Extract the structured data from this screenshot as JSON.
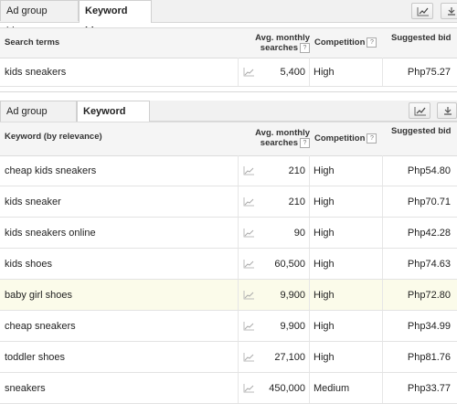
{
  "top_panel": {
    "tabs": [
      {
        "label": "Ad group ideas",
        "active": false
      },
      {
        "label": "Keyword ideas",
        "active": true
      }
    ],
    "headers": {
      "keyword": "Search terms",
      "avg_searches_line1": "Avg. monthly",
      "avg_searches_line2": "searches",
      "competition": "Competition",
      "suggested_bid": "Suggested bid",
      "help_glyph": "?"
    },
    "rows": [
      {
        "keyword": "kids sneakers",
        "searches": "5,400",
        "competition": "High",
        "bid": "Php75.27"
      }
    ]
  },
  "bottom_panel": {
    "tabs": [
      {
        "label": "Ad group ideas",
        "active": false
      },
      {
        "label": "Keyword ideas",
        "active": true
      }
    ],
    "headers": {
      "keyword": "Keyword (by relevance)",
      "avg_searches_line1": "Avg. monthly",
      "avg_searches_line2": "searches",
      "competition": "Competition",
      "suggested_bid": "Suggested bid",
      "help_glyph": "?"
    },
    "rows": [
      {
        "keyword": "cheap kids sneakers",
        "searches": "210",
        "competition": "High",
        "bid": "Php54.80",
        "highlighted": false
      },
      {
        "keyword": "kids sneaker",
        "searches": "210",
        "competition": "High",
        "bid": "Php70.71",
        "highlighted": false
      },
      {
        "keyword": "kids sneakers online",
        "searches": "90",
        "competition": "High",
        "bid": "Php42.28",
        "highlighted": false
      },
      {
        "keyword": "kids shoes",
        "searches": "60,500",
        "competition": "High",
        "bid": "Php74.63",
        "highlighted": false
      },
      {
        "keyword": "baby girl shoes",
        "searches": "9,900",
        "competition": "High",
        "bid": "Php72.80",
        "highlighted": true
      },
      {
        "keyword": "cheap sneakers",
        "searches": "9,900",
        "competition": "High",
        "bid": "Php34.99",
        "highlighted": false
      },
      {
        "keyword": "toddler shoes",
        "searches": "27,100",
        "competition": "High",
        "bid": "Php81.76",
        "highlighted": false
      },
      {
        "keyword": "sneakers",
        "searches": "450,000",
        "competition": "Medium",
        "bid": "Php33.77",
        "highlighted": false
      }
    ]
  },
  "icons": {
    "trend": "trend-chart-icon",
    "chart_button": "line-chart-icon",
    "download_button": "download-icon"
  },
  "colors": {
    "highlight_row": "#fbfbea",
    "header_bg": "#f5f5f5",
    "tab_bar_bg": "#f1f1f1"
  }
}
